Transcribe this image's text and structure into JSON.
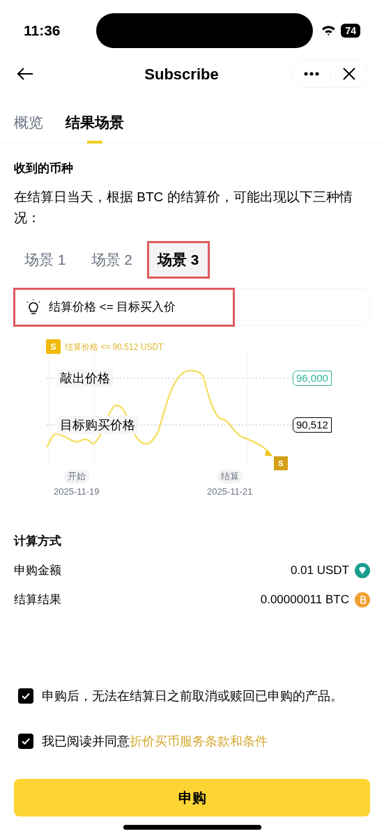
{
  "status_bar": {
    "time": "11:36",
    "battery": "74"
  },
  "header": {
    "title": "Subscribe"
  },
  "tabs": [
    {
      "label": "概览",
      "selected": false
    },
    {
      "label": "结果场景",
      "selected": true
    }
  ],
  "section_title": "收到的币种",
  "description": "在结算日当天，根据 BTC 的结算价，可能出现以下三种情况：",
  "scenarios": [
    {
      "label": "场景 1",
      "selected": false,
      "highlighted": false
    },
    {
      "label": "场景 2",
      "selected": false,
      "highlighted": false
    },
    {
      "label": "场景 3",
      "selected": true,
      "highlighted": true
    }
  ],
  "condition": {
    "text": "结算价格 <= 目标买入价",
    "highlighted": true
  },
  "illustration": {
    "legend_badge": "S",
    "legend": "结算价格 <= 90,512 USDT",
    "levels": [
      {
        "label": "敲出价格",
        "tag": "96,000",
        "kind": "knockout"
      },
      {
        "label": "目标购买价格",
        "tag": "90,512",
        "kind": "target"
      }
    ],
    "end_badge": "S",
    "dates": [
      {
        "label": "开始",
        "date": "2025-11-19"
      },
      {
        "label": "结算",
        "date": "2025-11-21"
      }
    ]
  },
  "calculation": {
    "title": "计算方式",
    "rows": [
      {
        "label": "申购金额",
        "value": "0.01 USDT",
        "kind": "usdt"
      },
      {
        "label": "结算结果",
        "value": "0.00000011 BTC",
        "kind": "btc"
      }
    ]
  },
  "agreements": [
    {
      "text": "申购后，无法在结算日之前取消或赎回已申购的产品。",
      "checked": true
    },
    {
      "text": "我已阅读并同意",
      "link": "折价买币服务条款和条件",
      "checked": true
    }
  ],
  "submit": "申购"
}
